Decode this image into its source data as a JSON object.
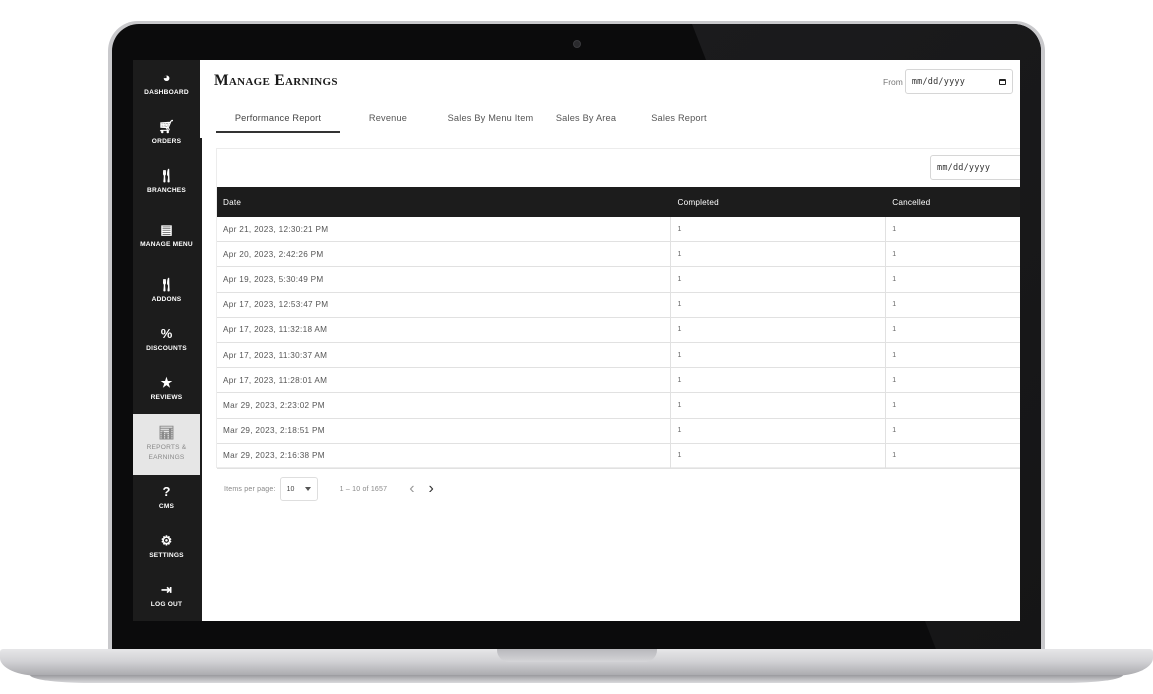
{
  "sidebar": {
    "items": [
      {
        "label": "Dashboard",
        "icon": "dashboard-icon",
        "glyph": "◕"
      },
      {
        "label": "Orders",
        "icon": "cart-icon",
        "glyph": "🛒︎"
      },
      {
        "label": "Branches",
        "icon": "utensils-icon",
        "glyph": "🍴︎"
      },
      {
        "label": "Manage Menu",
        "icon": "menu-book-icon",
        "glyph": "▤"
      },
      {
        "label": "Addons",
        "icon": "utensils-icon",
        "glyph": "🍴︎"
      },
      {
        "label": "Discounts",
        "icon": "percent-icon",
        "glyph": "%"
      },
      {
        "label": "Reviews",
        "icon": "star-icon",
        "glyph": "★"
      },
      {
        "label": "Reports & Earnings",
        "icon": "bar-chart-icon",
        "glyph": "📊︎"
      },
      {
        "label": "CMS",
        "icon": "question-icon",
        "glyph": "?"
      },
      {
        "label": "Settings",
        "icon": "gear-icon",
        "glyph": "⚙"
      },
      {
        "label": "Log Out",
        "icon": "logout-icon",
        "glyph": "⇥"
      }
    ],
    "active_index": 7
  },
  "page": {
    "title": "Manage Earnings",
    "from_label": "From",
    "from_value": "mm/dd/yyyy"
  },
  "tabs": [
    {
      "label": "Performance Report",
      "active": true
    },
    {
      "label": "Revenue",
      "active": false
    },
    {
      "label": "Sales By Menu Item",
      "active": false
    },
    {
      "label": "Sales By Area",
      "active": false
    },
    {
      "label": "Sales Report",
      "active": false
    }
  ],
  "filter": {
    "value": "mm/dd/yyyy"
  },
  "table": {
    "columns": [
      "Date",
      "Completed",
      "Cancelled"
    ],
    "rows": [
      [
        "Apr 21, 2023, 12:30:21 PM",
        "1",
        "1"
      ],
      [
        "Apr 20, 2023, 2:42:26 PM",
        "1",
        "1"
      ],
      [
        "Apr 19, 2023, 5:30:49 PM",
        "1",
        "1"
      ],
      [
        "Apr 17, 2023, 12:53:47 PM",
        "1",
        "1"
      ],
      [
        "Apr 17, 2023, 11:32:18 AM",
        "1",
        "1"
      ],
      [
        "Apr 17, 2023, 11:30:37 AM",
        "1",
        "1"
      ],
      [
        "Apr 17, 2023, 11:28:01 AM",
        "1",
        "1"
      ],
      [
        "Mar 29, 2023, 2:23:02 PM",
        "1",
        "1"
      ],
      [
        "Mar 29, 2023, 2:18:51 PM",
        "1",
        "1"
      ],
      [
        "Mar 29, 2023, 2:16:38 PM",
        "1",
        "1"
      ]
    ]
  },
  "pagination": {
    "items_per_page_label": "Items per page:",
    "items_per_page": "10",
    "range_label": "1 – 10 of 1657",
    "prev_glyph": "‹",
    "next_glyph": "›"
  }
}
